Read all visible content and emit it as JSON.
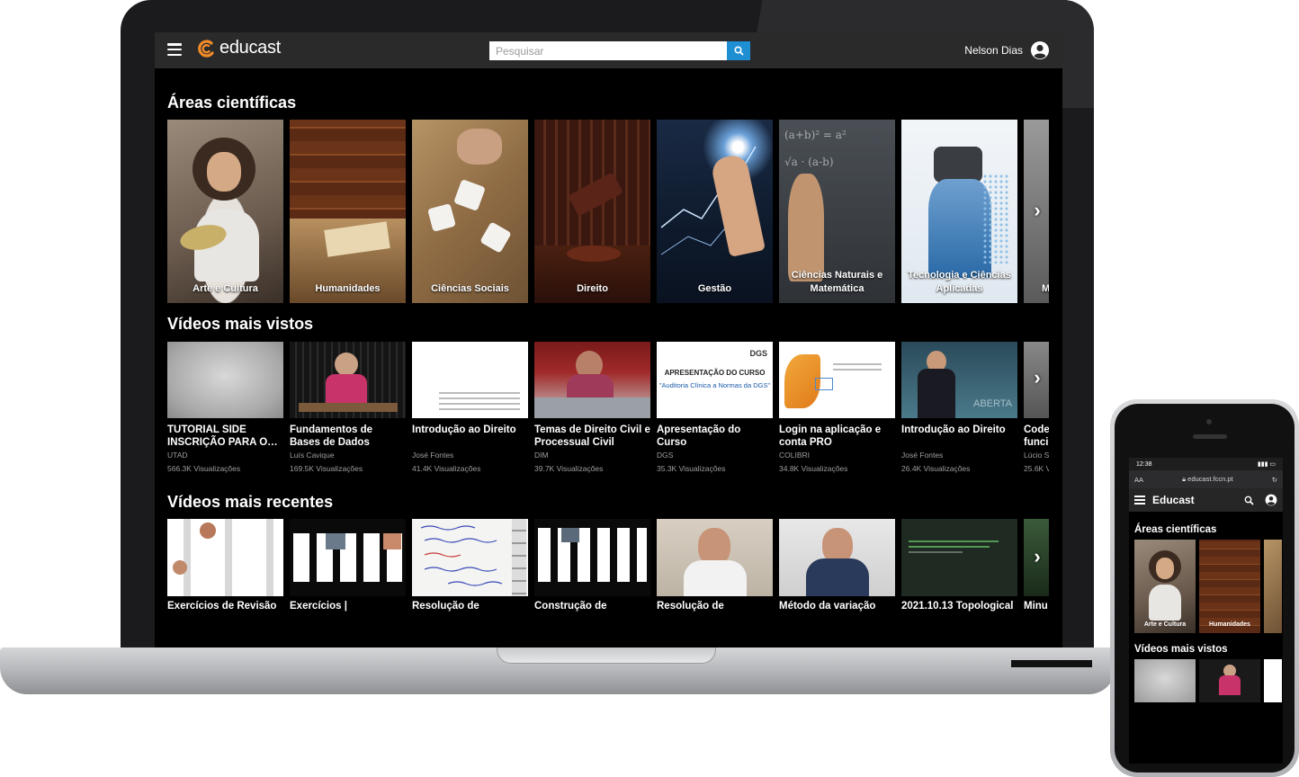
{
  "app": {
    "name": "educast"
  },
  "search": {
    "placeholder": "Pesquisar"
  },
  "user": {
    "name": "Nelson Dias"
  },
  "colors": {
    "accent": "#1f8fd3",
    "logo": "#f28c28",
    "background": "#000000",
    "topbar": "#2a2a2a"
  },
  "sections": {
    "areas": {
      "title": "Áreas científicas",
      "items": [
        {
          "label": "Arte e Cultura"
        },
        {
          "label": "Humanidades"
        },
        {
          "label": "Ciências Sociais"
        },
        {
          "label": "Direito"
        },
        {
          "label": "Gestão"
        },
        {
          "label": "Ciências Naturais e Matemática"
        },
        {
          "label": "Tecnologia e Ciências Aplicadas"
        },
        {
          "label": "M"
        }
      ]
    },
    "most_viewed": {
      "title": "Vídeos mais vistos",
      "items": [
        {
          "title": "TUTORIAL SIDE INSCRIÇÃO PARA O…",
          "author": "UTAD",
          "views": "566.3K Visualizações"
        },
        {
          "title": "Fundamentos de Bases de Dados",
          "author": "Luís Cavique",
          "views": "169.5K Visualizações"
        },
        {
          "title": "Introdução ao Direito",
          "author": "José Fontes",
          "views": "41.4K Visualizações"
        },
        {
          "title": "Temas de Direito Civil e Processual Civil",
          "author": "DIM",
          "views": "39.7K Visualizações"
        },
        {
          "title": "Apresentação do Curso",
          "author": "DGS",
          "views": "35.3K Visualizações"
        },
        {
          "title": "Login na aplicação e conta PRO",
          "author": "COLIBRI",
          "views": "34.8K Visualizações"
        },
        {
          "title": "Introdução ao Direito",
          "author": "José Fontes",
          "views": "26.4K Visualizações"
        },
        {
          "title": "Code funci",
          "author": "Lúcio S",
          "views": "25.6K V"
        }
      ],
      "thumb_text": {
        "dgs_brand": "DGS",
        "dgs_heading": "APRESENTAÇÃO DO CURSO",
        "dgs_subtitle": "\"Auditoria Clínica a Normas da DGS\"",
        "aberta": "ABERTA"
      }
    },
    "recent": {
      "title": "Vídeos mais recentes",
      "items": [
        {
          "title": "Exercícios de Revisão"
        },
        {
          "title": "Exercícios |"
        },
        {
          "title": "Resolução de"
        },
        {
          "title": "Construção de"
        },
        {
          "title": "Resolução de"
        },
        {
          "title": "Método da variação"
        },
        {
          "title": "2021.10.13 Topological"
        },
        {
          "title": "Minu"
        }
      ]
    }
  },
  "phone": {
    "time": "12:38",
    "text_size": "AA",
    "url": "educast.fccn.pt",
    "app_title": "Educast",
    "areas_title": "Áreas científicas",
    "areas": [
      {
        "label": "Arte e Cultura"
      },
      {
        "label": "Humanidades"
      }
    ],
    "most_viewed_title": "Vídeos mais vistos"
  },
  "icons": {
    "menu": "hamburger-icon",
    "search": "magnifier-icon",
    "user": "user-circle-icon",
    "next": "chevron-right-icon",
    "lock": "lock-icon",
    "reload": "reload-icon"
  }
}
